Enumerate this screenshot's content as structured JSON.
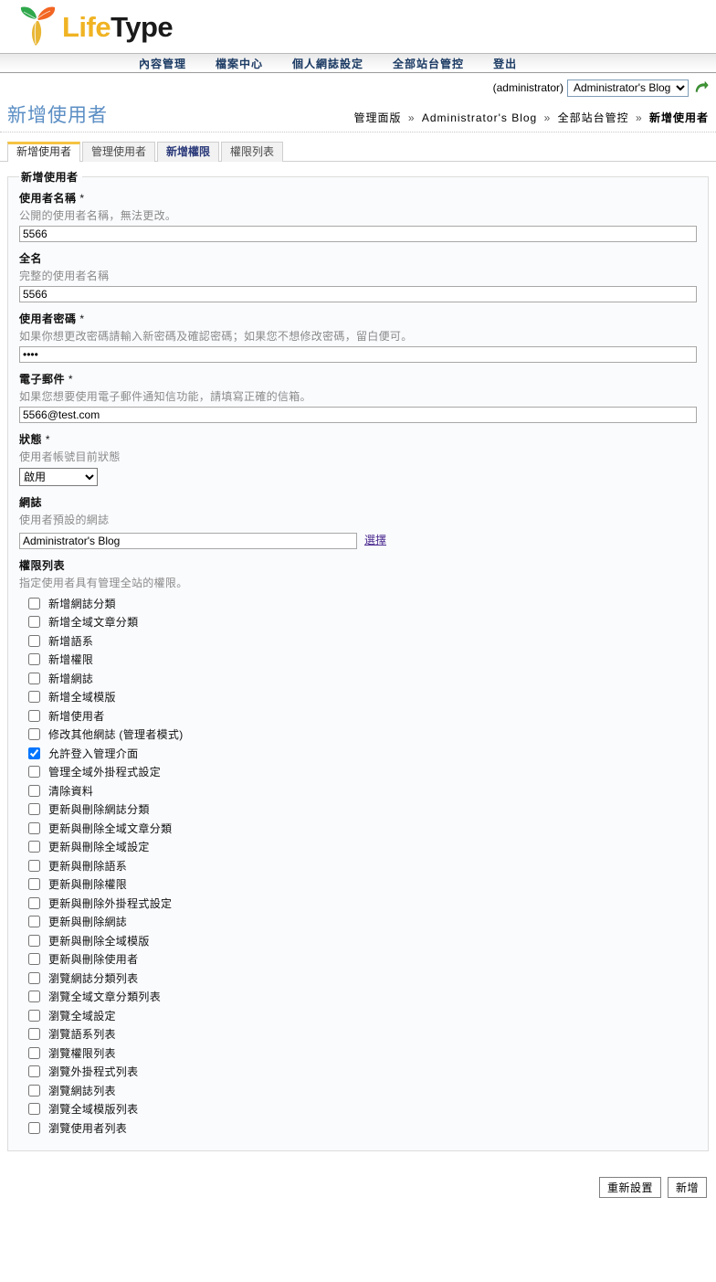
{
  "brand": {
    "name_part1": "Life",
    "name_part2": "Type",
    "leaf_green": "#2fa84b",
    "leaf_orange": "#f26522",
    "leaf_gold": "#e8b633"
  },
  "nav": {
    "items": [
      {
        "label": "內容管理"
      },
      {
        "label": "檔案中心"
      },
      {
        "label": "個人網誌設定"
      },
      {
        "label": "全部站台管控"
      },
      {
        "label": "登出"
      }
    ]
  },
  "blog_selector": {
    "username": "(administrator)",
    "selected_blog": "Administrator's Blog",
    "go_icon": "green-arrow-icon"
  },
  "page": {
    "title": "新增使用者"
  },
  "breadcrumb": {
    "items": [
      "管理面版",
      "Administrator's Blog",
      "全部站台管控",
      "新增使用者"
    ],
    "separator": "»"
  },
  "tabs": [
    {
      "label": "新增使用者",
      "state": "active"
    },
    {
      "label": "管理使用者",
      "state": "normal"
    },
    {
      "label": "新增權限",
      "state": "highlight"
    },
    {
      "label": "權限列表",
      "state": "normal"
    }
  ],
  "form": {
    "legend": "新增使用者",
    "username": {
      "label": "使用者名稱",
      "required_mark": "*",
      "hint": "公開的使用者名稱，無法更改。",
      "value": "5566"
    },
    "fullname": {
      "label": "全名",
      "required_mark": "",
      "hint": "完整的使用者名稱",
      "value": "5566"
    },
    "password": {
      "label": "使用者密碼",
      "required_mark": "*",
      "hint": "如果你想更改密碼請輸入新密碼及確認密碼；如果您不想修改密碼，留白便可。",
      "value": "****"
    },
    "email": {
      "label": "電子郵件",
      "required_mark": "*",
      "hint": "如果您想要使用電子郵件通知信功能，請填寫正確的信箱。",
      "value": "5566@test.com"
    },
    "status": {
      "label": "狀態",
      "required_mark": "*",
      "hint": "使用者帳號目前狀態",
      "selected": "啟用"
    },
    "blog": {
      "label": "網誌",
      "required_mark": "",
      "hint": "使用者預設的網誌",
      "value": "Administrator's Blog",
      "pick_label": "選擇"
    },
    "permissions": {
      "label": "權限列表",
      "hint": "指定使用者具有管理全站的權限。",
      "items": [
        {
          "label": "新增網誌分類",
          "checked": false
        },
        {
          "label": "新增全域文章分類",
          "checked": false
        },
        {
          "label": "新增語系",
          "checked": false
        },
        {
          "label": "新增權限",
          "checked": false
        },
        {
          "label": "新增網誌",
          "checked": false
        },
        {
          "label": "新增全域模版",
          "checked": false
        },
        {
          "label": "新增使用者",
          "checked": false
        },
        {
          "label": "修改其他網誌 (管理者模式)",
          "checked": false
        },
        {
          "label": "允許登入管理介面",
          "checked": true
        },
        {
          "label": "管理全域外掛程式設定",
          "checked": false
        },
        {
          "label": "清除資料",
          "checked": false
        },
        {
          "label": "更新與刪除網誌分類",
          "checked": false
        },
        {
          "label": "更新與刪除全域文章分類",
          "checked": false
        },
        {
          "label": "更新與刪除全域設定",
          "checked": false
        },
        {
          "label": "更新與刪除語系",
          "checked": false
        },
        {
          "label": "更新與刪除權限",
          "checked": false
        },
        {
          "label": "更新與刪除外掛程式設定",
          "checked": false
        },
        {
          "label": "更新與刪除網誌",
          "checked": false
        },
        {
          "label": "更新與刪除全域模版",
          "checked": false
        },
        {
          "label": "更新與刪除使用者",
          "checked": false
        },
        {
          "label": "瀏覽網誌分類列表",
          "checked": false
        },
        {
          "label": "瀏覽全域文章分類列表",
          "checked": false
        },
        {
          "label": "瀏覽全域設定",
          "checked": false
        },
        {
          "label": "瀏覽語系列表",
          "checked": false
        },
        {
          "label": "瀏覽權限列表",
          "checked": false
        },
        {
          "label": "瀏覽外掛程式列表",
          "checked": false
        },
        {
          "label": "瀏覽網誌列表",
          "checked": false
        },
        {
          "label": "瀏覽全域模版列表",
          "checked": false
        },
        {
          "label": "瀏覽使用者列表",
          "checked": false
        }
      ]
    }
  },
  "footer": {
    "reset_label": "重新設置",
    "submit_label": "新增"
  }
}
